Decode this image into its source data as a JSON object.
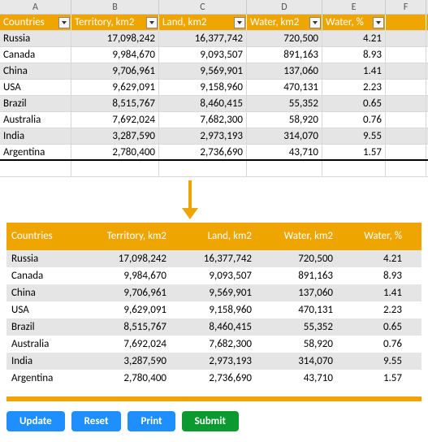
{
  "cols": [
    "A",
    "B",
    "C",
    "D",
    "E",
    "F"
  ],
  "headers": {
    "c1": "Countries",
    "c2": "Territory, km2",
    "c3": "Land, km2",
    "c4": "Water, km2",
    "c5": "Water, %"
  },
  "rows": [
    {
      "c1": "Russia",
      "c2": "17,098,242",
      "c3": "16,377,742",
      "c4": "720,500",
      "c5": "4.21"
    },
    {
      "c1": "Canada",
      "c2": "9,984,670",
      "c3": "9,093,507",
      "c4": "891,163",
      "c5": "8.93"
    },
    {
      "c1": "China",
      "c2": "9,706,961",
      "c3": "9,569,901",
      "c4": "137,060",
      "c5": "1.41"
    },
    {
      "c1": "USA",
      "c2": "9,629,091",
      "c3": "9,158,960",
      "c4": "470,131",
      "c5": "2.23"
    },
    {
      "c1": "Brazil",
      "c2": "8,515,767",
      "c3": "8,460,415",
      "c4": "55,352",
      "c5": "0.65"
    },
    {
      "c1": "Australia",
      "c2": "7,692,024",
      "c3": "7,682,300",
      "c4": "58,920",
      "c5": "0.76"
    },
    {
      "c1": "India",
      "c2": "3,287,590",
      "c3": "2,973,193",
      "c4": "314,070",
      "c5": "9.55"
    },
    {
      "c1": "Argentina",
      "c2": "2,780,400",
      "c3": "2,736,690",
      "c4": "43,710",
      "c5": "1.57"
    }
  ],
  "buttons": {
    "update": "Update",
    "reset": "Reset",
    "print": "Print",
    "submit": "Submit"
  }
}
